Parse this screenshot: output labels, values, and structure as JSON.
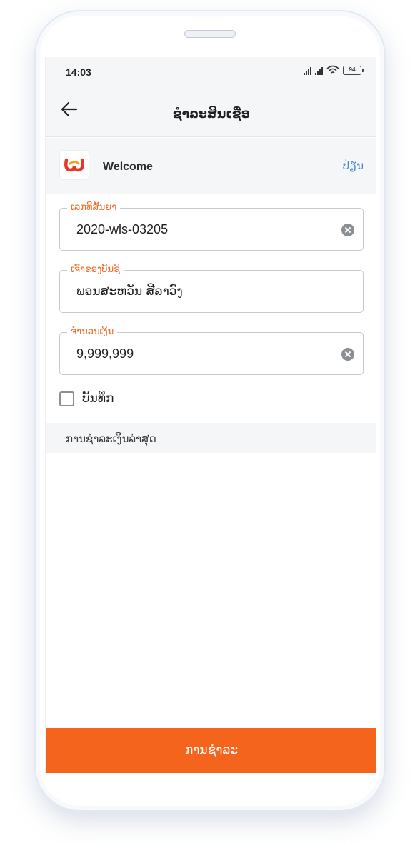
{
  "status_bar": {
    "time": "14:03",
    "battery": "94"
  },
  "app_bar": {
    "title": "ຊຳລະສິນເຊື່ອ"
  },
  "provider": {
    "name": "Welcome",
    "change_label": "ປ່ຽນ"
  },
  "form": {
    "contract": {
      "label": "ເລກທີສັນຍາ",
      "value": "2020-wls-03205"
    },
    "owner": {
      "label": "ເຈົ້າຂອງບັນຊີ",
      "value": "ພອນສະຫວັນ ສີລາວົງ"
    },
    "amount": {
      "label": "ຈຳນວນເງິນ",
      "value": "9,999,999"
    },
    "save_label": "ບັນທຶກ"
  },
  "recent": {
    "title": "ການຊຳລະເງິນລ່າສຸດ"
  },
  "pay_button": {
    "label": "ການຊຳລະ"
  },
  "colors": {
    "accent": "#f5641c",
    "label": "#ef6a25",
    "link": "#3f8bd6"
  },
  "icons": [
    "back-arrow-icon",
    "signal-icon",
    "wifi-icon",
    "battery-icon",
    "welcome-logo-icon",
    "clear-icon"
  ]
}
